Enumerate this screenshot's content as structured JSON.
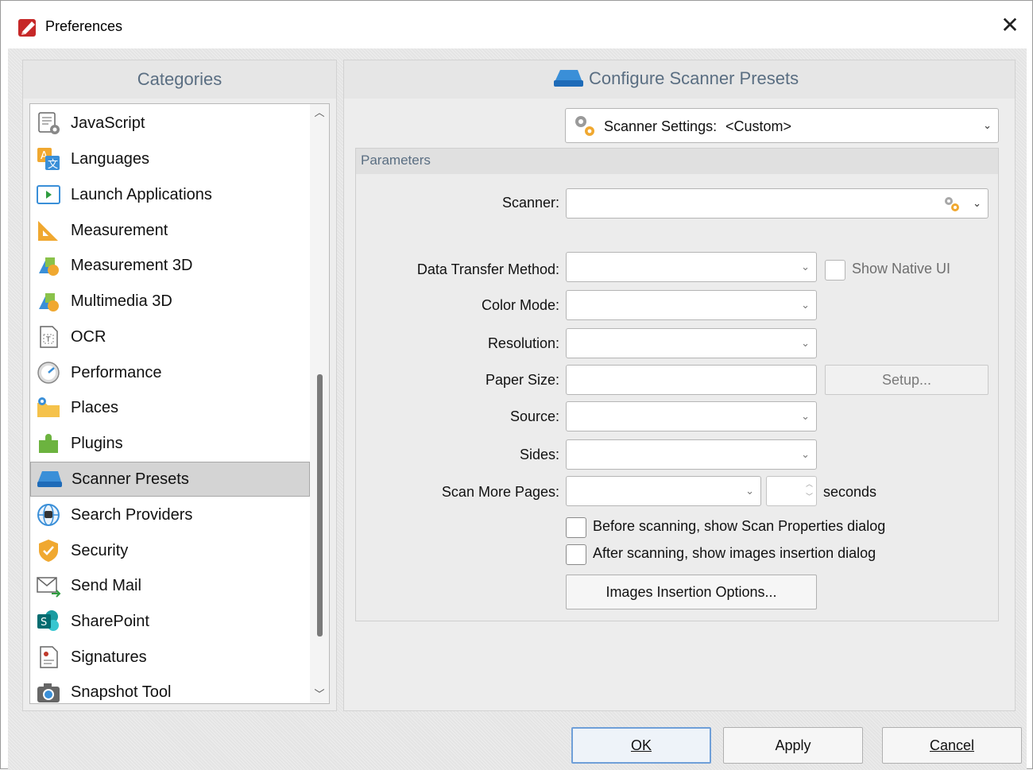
{
  "window": {
    "title": "Preferences",
    "close_glyph": "✕"
  },
  "categories": {
    "header": "Categories",
    "items": [
      {
        "label": "JavaScript",
        "icon": "javascript-icon"
      },
      {
        "label": "Languages",
        "icon": "languages-icon"
      },
      {
        "label": "Launch Applications",
        "icon": "launch-applications-icon"
      },
      {
        "label": "Measurement",
        "icon": "measurement-icon"
      },
      {
        "label": "Measurement 3D",
        "icon": "measurement-3d-icon"
      },
      {
        "label": "Multimedia 3D",
        "icon": "multimedia-3d-icon"
      },
      {
        "label": "OCR",
        "icon": "ocr-icon"
      },
      {
        "label": "Performance",
        "icon": "performance-icon"
      },
      {
        "label": "Places",
        "icon": "places-icon"
      },
      {
        "label": "Plugins",
        "icon": "plugins-icon"
      },
      {
        "label": "Scanner Presets",
        "icon": "scanner-presets-icon",
        "selected": true
      },
      {
        "label": "Search Providers",
        "icon": "search-providers-icon"
      },
      {
        "label": "Security",
        "icon": "security-icon"
      },
      {
        "label": "Send Mail",
        "icon": "send-mail-icon"
      },
      {
        "label": "SharePoint",
        "icon": "sharepoint-icon"
      },
      {
        "label": "Signatures",
        "icon": "signatures-icon"
      },
      {
        "label": "Snapshot Tool",
        "icon": "snapshot-tool-icon"
      }
    ]
  },
  "main": {
    "header": "Configure Scanner Presets",
    "preset_combo": {
      "label": "Scanner Settings:",
      "value": "<Custom>"
    },
    "parameters": {
      "title": "Parameters",
      "scanner_label": "Scanner:",
      "data_transfer_label": "Data Transfer Method:",
      "show_native_ui_label": "Show Native UI",
      "color_mode_label": "Color Mode:",
      "resolution_label": "Resolution:",
      "paper_size_label": "Paper Size:",
      "setup_button": "Setup...",
      "source_label": "Source:",
      "sides_label": "Sides:",
      "scan_more_label": "Scan More Pages:",
      "seconds_label": "seconds",
      "before_scan_label": "Before scanning, show Scan Properties dialog",
      "after_scan_label": "After scanning, show images insertion dialog",
      "insertion_options_button": "Images Insertion Options..."
    }
  },
  "footer": {
    "ok": "OK",
    "apply": "Apply",
    "cancel": "Cancel"
  },
  "colors": {
    "header_text": "#5a6e82",
    "selected_bg": "#d4d4d4",
    "default_button_border": "#6f9fd8"
  }
}
